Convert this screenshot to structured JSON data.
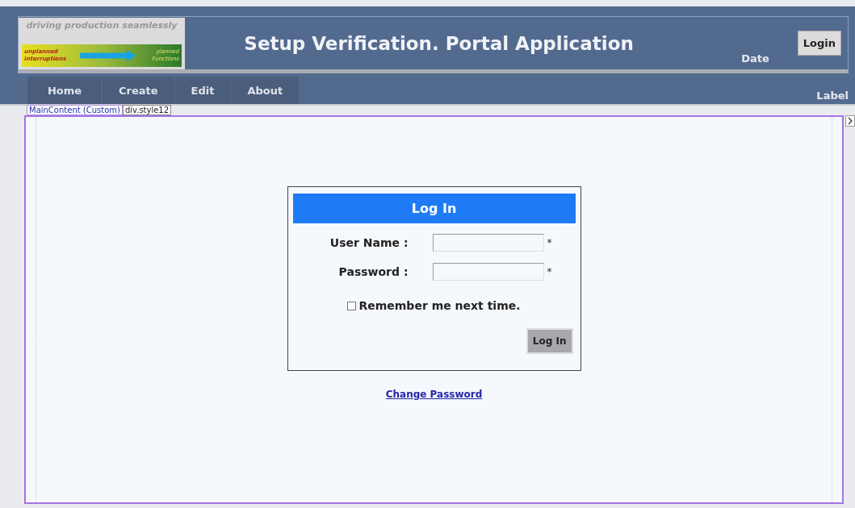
{
  "logo": {
    "slogan": "driving production seamlessly",
    "left_text": "unplanned interruptions",
    "right_text": "planned Functions"
  },
  "title": "Setup Verification. Portal Application",
  "date_label": "Date",
  "login_button": "Login",
  "menu": [
    "Home",
    "Create",
    "Edit",
    "About"
  ],
  "menu_label": "Label",
  "designer_tags": [
    "MainContent (Custom)",
    "div.style12"
  ],
  "login_box": {
    "heading": "Log In",
    "fields": [
      {
        "label": "User Name :",
        "required_mark": "*"
      },
      {
        "label": "Password :",
        "required_mark": "*"
      }
    ],
    "remember": {
      "label": "Remember me next time.",
      "checked": false
    },
    "submit": "Log In"
  },
  "change_password_link": "Change Password"
}
